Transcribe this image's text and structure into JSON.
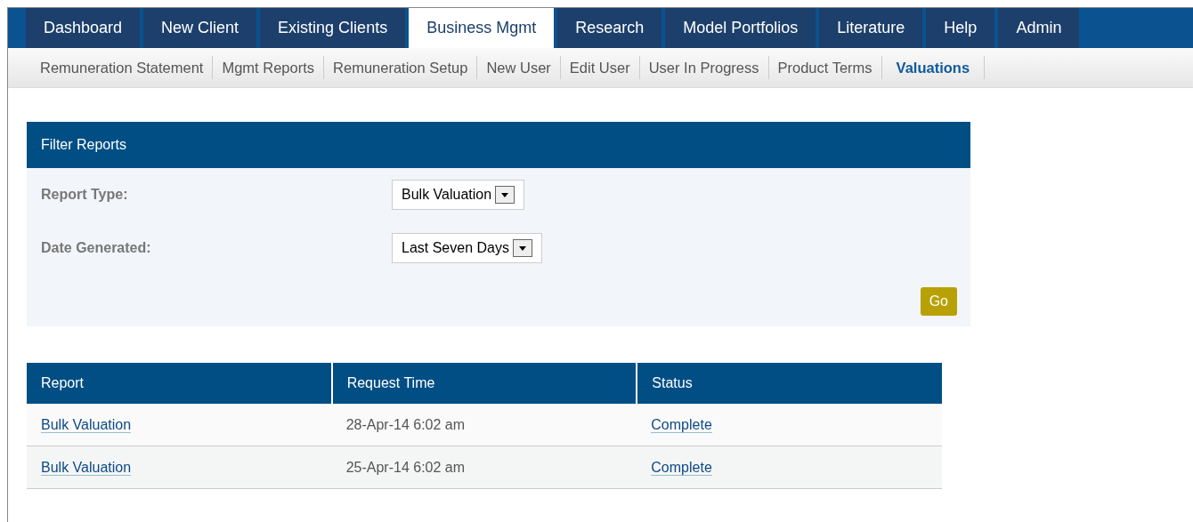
{
  "tabs": [
    {
      "label": "Dashboard",
      "selected": false
    },
    {
      "label": "New Client",
      "selected": false
    },
    {
      "label": "Existing Clients",
      "selected": false
    },
    {
      "label": "Business Mgmt",
      "selected": true
    },
    {
      "label": "Research",
      "selected": false
    },
    {
      "label": "Model Portfolios",
      "selected": false
    },
    {
      "label": "Literature",
      "selected": false
    },
    {
      "label": "Help",
      "selected": false
    },
    {
      "label": "Admin",
      "selected": false
    }
  ],
  "subnav": [
    {
      "label": "Remuneration Statement",
      "selected": false
    },
    {
      "label": "Mgmt Reports",
      "selected": false
    },
    {
      "label": "Remuneration Setup",
      "selected": false
    },
    {
      "label": "New User",
      "selected": false
    },
    {
      "label": "Edit User",
      "selected": false
    },
    {
      "label": "User In Progress",
      "selected": false
    },
    {
      "label": "Product Terms",
      "selected": false
    },
    {
      "label": "Valuations",
      "selected": true
    }
  ],
  "filter": {
    "title": "Filter Reports",
    "fields": [
      {
        "label": "Report Type:",
        "value": "Bulk Valuation"
      },
      {
        "label": "Date Generated:",
        "value": "Last Seven Days"
      }
    ],
    "button": "Go"
  },
  "table": {
    "columns": [
      "Report",
      "Request Time",
      "Status"
    ],
    "rows": [
      [
        "Bulk Valuation",
        "28-Apr-14 6:02 am",
        "Complete"
      ],
      [
        "Bulk Valuation",
        "25-Apr-14 6:02 am",
        "Complete"
      ]
    ]
  }
}
